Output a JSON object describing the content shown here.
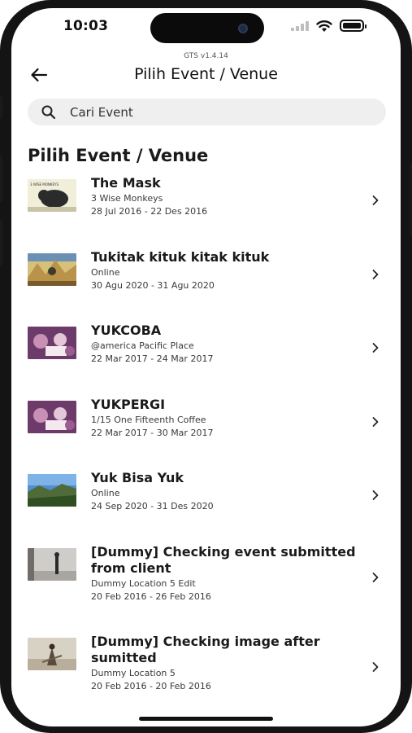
{
  "status_bar": {
    "time": "10:03"
  },
  "header": {
    "version": "GTS v1.4.14",
    "title": "Pilih Event / Venue"
  },
  "search": {
    "placeholder": "Cari Event"
  },
  "section_title": "Pilih Event / Venue",
  "events": [
    {
      "title": "The Mask",
      "venue": "3 Wise Monkeys",
      "dates": "28 Jul 2016 - 22 Des 2016",
      "thumb_text": "3 WISE MONKEYS"
    },
    {
      "title": "Tukitak kituk kitak kituk",
      "venue": "Online",
      "dates": "30 Agu 2020 - 31 Agu 2020"
    },
    {
      "title": "YUKCOBA",
      "venue": "@america Pacific Place",
      "dates": "22 Mar 2017 - 24 Mar 2017"
    },
    {
      "title": "YUKPERGI",
      "venue": "1/15 One Fifteenth Coffee",
      "dates": "22 Mar 2017 - 30 Mar 2017"
    },
    {
      "title": "Yuk Bisa Yuk",
      "venue": "Online",
      "dates": "24 Sep 2020 - 31 Des 2020"
    },
    {
      "title": "[Dummy] Checking event submitted from client",
      "venue": "Dummy Location 5 Edit",
      "dates": "20 Feb 2016 - 26 Feb 2016"
    },
    {
      "title": "[Dummy] Checking image after sumitted",
      "venue": "Dummy Location 5",
      "dates": "20 Feb 2016 - 20 Feb 2016"
    }
  ],
  "icons": {
    "back": "arrow-left-icon",
    "search": "search-icon",
    "chevron": "chevron-right-icon"
  }
}
